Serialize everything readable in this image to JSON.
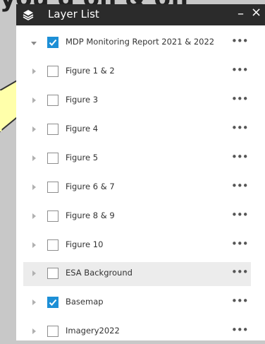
{
  "background": {
    "partial_text": "you d on & off"
  },
  "panel": {
    "title": "Layer List",
    "minimize_label": "–",
    "close_label": "×",
    "more_label": "•••"
  },
  "layers": [
    {
      "label": "MDP Monitoring Report 2021 & 2022",
      "checked": true,
      "expanded": true,
      "level": 0
    },
    {
      "label": "Figure 1 & 2",
      "checked": false,
      "expanded": false,
      "level": 1
    },
    {
      "label": "Figure 3",
      "checked": false,
      "expanded": false,
      "level": 1
    },
    {
      "label": "Figure 4",
      "checked": false,
      "expanded": false,
      "level": 1
    },
    {
      "label": "Figure 5",
      "checked": false,
      "expanded": false,
      "level": 1
    },
    {
      "label": "Figure 6 & 7",
      "checked": false,
      "expanded": false,
      "level": 1
    },
    {
      "label": "Figure 8 & 9",
      "checked": false,
      "expanded": false,
      "level": 1
    },
    {
      "label": "Figure 10",
      "checked": false,
      "expanded": false,
      "level": 1
    },
    {
      "label": "ESA Background",
      "checked": false,
      "expanded": false,
      "level": 0,
      "highlighted": true
    },
    {
      "label": "Basemap",
      "checked": true,
      "expanded": false,
      "level": 0
    },
    {
      "label": "Imagery2022",
      "checked": false,
      "expanded": false,
      "level": 0
    }
  ],
  "colors": {
    "header_bg": "#2b2b2b",
    "checkbox_checked": "#1d8fd6",
    "highlight_row": "#ececec",
    "callout_fill": "#ffffaa"
  }
}
